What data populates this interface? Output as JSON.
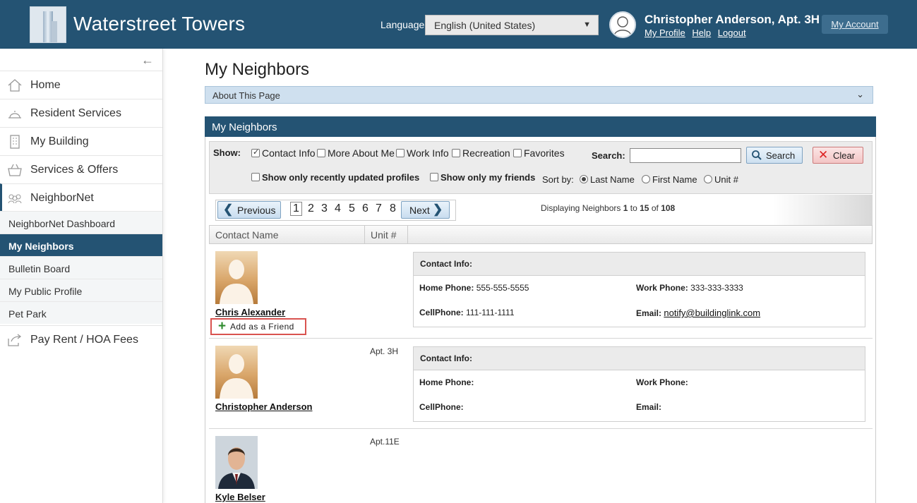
{
  "header": {
    "brand": "Waterstreet Towers",
    "language_label": "Language:",
    "language_value": "English (United States)",
    "user_name": "Christopher Anderson, Apt. 3H",
    "links": [
      "My Profile",
      "Help",
      "Logout"
    ],
    "my_account": "My Account"
  },
  "sidebar": {
    "items": [
      {
        "label": "Home",
        "icon": "home-icon"
      },
      {
        "label": "Resident Services",
        "icon": "bell-icon"
      },
      {
        "label": "My Building",
        "icon": "building-icon"
      },
      {
        "label": "Services & Offers",
        "icon": "basket-icon"
      },
      {
        "label": "NeighborNet",
        "icon": "people-icon"
      }
    ],
    "sub_items": [
      "NeighborNet Dashboard",
      "My Neighbors",
      "Bulletin Board",
      "My Public Profile",
      "Pet Park"
    ],
    "pay": {
      "label": "Pay Rent / HOA Fees",
      "icon": "share-icon"
    }
  },
  "main": {
    "title": "My Neighbors",
    "about": "About This Page",
    "panel_title": "My Neighbors",
    "filters": {
      "show_label": "Show:",
      "contact_info": "Contact Info",
      "more_about_me": "More About Me",
      "work_info": "Work Info",
      "recreation": "Recreation",
      "favorites": "Favorites",
      "recent_only": "Show only recently updated profiles",
      "friends_only": "Show only my friends",
      "sort_by": "Sort by:",
      "sort_last": "Last Name",
      "sort_first": "First Name",
      "sort_unit": "Unit #",
      "search_label": "Search:",
      "search_button": "Search",
      "clear_button": "Clear"
    },
    "pager": {
      "previous": "Previous",
      "next": "Next",
      "pages": [
        "1",
        "2",
        "3",
        "4",
        "5",
        "6",
        "7",
        "8"
      ],
      "display_prefix": "Displaying Neighbors",
      "display_from": "1",
      "display_to_word": "to",
      "display_to": "15",
      "display_of_word": "of",
      "display_total": "108"
    },
    "columns": [
      "Contact Name",
      "Unit #"
    ],
    "neighbors": [
      {
        "name": "Chris Alexander",
        "unit": "",
        "add_friend": "Add as a Friend",
        "contact_title": "Contact Info:",
        "home_label": "Home Phone:",
        "home": "555-555-5555",
        "work_label": "Work Phone:",
        "work": "333-333-3333",
        "cell_label": "CellPhone:",
        "cell": "111-111-1111",
        "email_label": "Email:",
        "email": "notify@buildinglink.com"
      },
      {
        "name": "Christopher Anderson",
        "unit": "Apt. 3H",
        "contact_title": "Contact Info:",
        "home_label": "Home Phone:",
        "home": "",
        "work_label": "Work Phone:",
        "work": "",
        "cell_label": "CellPhone:",
        "cell": "",
        "email_label": "Email:",
        "email": ""
      },
      {
        "name": "Kyle Belser",
        "unit": "Apt.11E"
      }
    ]
  }
}
